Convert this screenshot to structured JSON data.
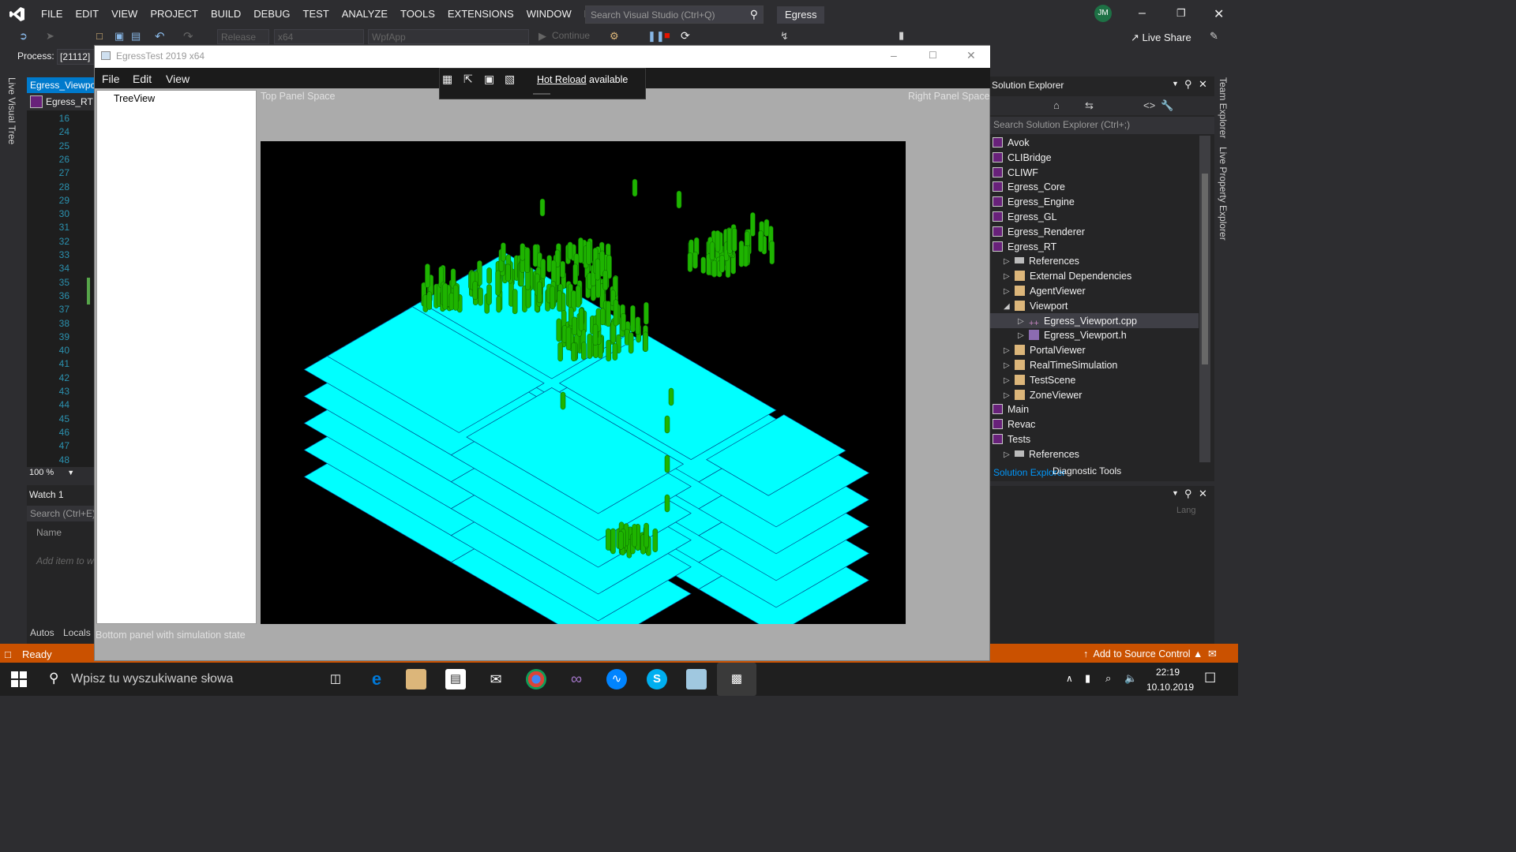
{
  "vs": {
    "menu": [
      "FILE",
      "EDIT",
      "VIEW",
      "PROJECT",
      "BUILD",
      "DEBUG",
      "TEST",
      "ANALYZE",
      "TOOLS",
      "EXTENSIONS",
      "WINDOW",
      "HELP"
    ],
    "search_placeholder": "Search Visual Studio (Ctrl+Q)",
    "solution_name": "Egress",
    "user_initials": "JM",
    "toolbar": {
      "config": "Release",
      "platform": "x64",
      "startup": "WpfApp",
      "continue": "Continue",
      "live_share": "Live Share"
    },
    "process_label": "Process:",
    "process_value": "[21112]",
    "left_rail": "Live Visual Tree",
    "editor": {
      "tab": "Egress_Viewport.cpp",
      "nav": "Egress_RT",
      "line_numbers": [
        "16",
        "24",
        "25",
        "26",
        "27",
        "28",
        "29",
        "30",
        "31",
        "32",
        "33",
        "34",
        "35",
        "36",
        "37",
        "38",
        "39",
        "40",
        "41",
        "42",
        "43",
        "44",
        "45",
        "46",
        "47",
        "48"
      ],
      "zoom": "100 %"
    },
    "watch": {
      "title": "Watch 1",
      "search": "Search (Ctrl+E)",
      "column_name": "Name",
      "add_hint": "Add item to watch",
      "tabs": [
        "Autos",
        "Locals"
      ]
    },
    "solution_explorer": {
      "title": "Solution Explorer",
      "search": "Search Solution Explorer (Ctrl+;)",
      "items": [
        {
          "label": "Avok",
          "icon": "project-icon",
          "indent": 0
        },
        {
          "label": "CLIBridge",
          "icon": "project-icon",
          "indent": 0
        },
        {
          "label": "CLIWF",
          "icon": "project-icon",
          "indent": 0
        },
        {
          "label": "Egress_Core",
          "icon": "project-icon",
          "indent": 0
        },
        {
          "label": "Egress_Engine",
          "icon": "project-icon",
          "indent": 0
        },
        {
          "label": "Egress_GL",
          "icon": "project-icon",
          "indent": 0
        },
        {
          "label": "Egress_Renderer",
          "icon": "project-icon",
          "indent": 0
        },
        {
          "label": "Egress_RT",
          "icon": "project-icon",
          "indent": 0
        },
        {
          "label": "References",
          "icon": "references-icon",
          "indent": 1
        },
        {
          "label": "External Dependencies",
          "icon": "dependencies-icon",
          "indent": 1
        },
        {
          "label": "AgentViewer",
          "icon": "folder-icon",
          "indent": 1
        },
        {
          "label": "Viewport",
          "icon": "folder-icon",
          "indent": 1
        },
        {
          "label": "Egress_Viewport.cpp",
          "icon": "cpp-file-icon",
          "indent": 2
        },
        {
          "label": "Egress_Viewport.h",
          "icon": "header-file-icon",
          "indent": 2
        },
        {
          "label": "PortalViewer",
          "icon": "folder-icon",
          "indent": 1
        },
        {
          "label": "RealTimeSimulation",
          "icon": "folder-icon",
          "indent": 1
        },
        {
          "label": "TestScene",
          "icon": "folder-icon",
          "indent": 1
        },
        {
          "label": "ZoneViewer",
          "icon": "folder-icon",
          "indent": 1
        },
        {
          "label": "Main",
          "icon": "project-icon",
          "indent": 0
        },
        {
          "label": "Revac",
          "icon": "project-icon",
          "indent": 0
        },
        {
          "label": "Tests",
          "icon": "project-icon",
          "indent": 0
        },
        {
          "label": "References",
          "icon": "references-icon",
          "indent": 1
        }
      ],
      "selected": "Egress_Viewport.cpp",
      "tabs": [
        "Solution Explorer",
        "Diagnostic Tools"
      ]
    },
    "properties_lang": "Lang",
    "right_rail": [
      "Team Explorer",
      "Live Property Explorer"
    ],
    "status": {
      "ready": "Ready",
      "source_control": "Add to Source Control"
    }
  },
  "app": {
    "title": "EgressTest 2019 x64",
    "menu": [
      "File",
      "Edit",
      "View"
    ],
    "hot_reload_link": "Hot Reload",
    "hot_reload_suffix": " available",
    "treeview_label": "TreeView",
    "top_panel_label": "Top Panel Space",
    "right_panel_label": "Right Panel Space",
    "bottom_panel_label": "Bottom panel with simulation state",
    "scene_colors": {
      "floor": "#00ffff",
      "agents": "#1eb400",
      "background": "#000000"
    }
  },
  "taskbar": {
    "search_placeholder": "Wpisz tu wyszukiwane słowa",
    "time": "22:19",
    "date": "10.10.2019"
  }
}
